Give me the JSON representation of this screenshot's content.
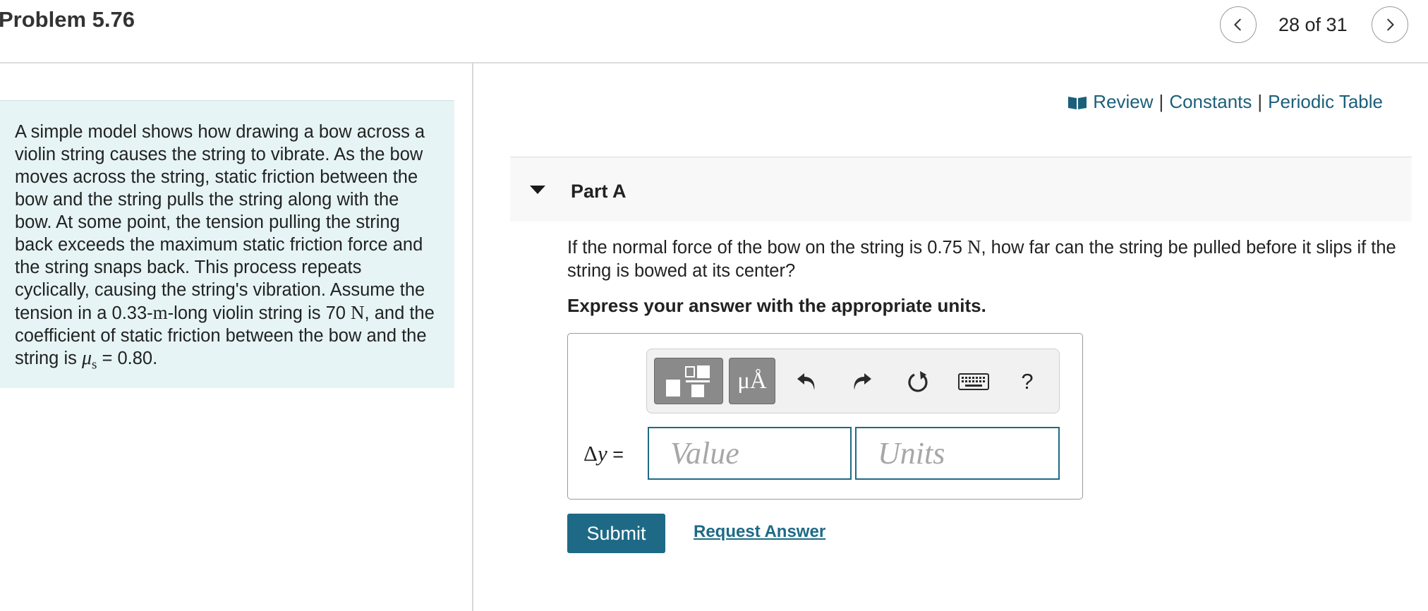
{
  "header": {
    "title": "Problem 5.76",
    "nav": {
      "counter": "28 of 31"
    }
  },
  "problem": {
    "text": {
      "p1": "A simple model shows how drawing a bow across a violin string causes the string to vibrate. As the bow moves across the string, static friction between the bow and the string pulls the string along with the bow. At some point, the tension pulling the string back exceeds the maximum static friction force and the string snaps back. This process repeats cyclically, causing the string's vibration. Assume the tension in a 0.33-",
      "unit_m": "m",
      "p2": "-long violin string is 70 ",
      "unit_n": "N",
      "p3": ", and the coefficient of static friction between the bow and the string is ",
      "mu_symbol": "μ",
      "mu_sub": "s",
      "p4": " = 0.80."
    }
  },
  "resources": {
    "review": "Review",
    "separator": "|",
    "constants": "Constants",
    "periodic_table": "Periodic Table"
  },
  "part": {
    "label": "Part A",
    "question": {
      "q1": "If the normal force of the bow on the string is 0.75 ",
      "unit_n": "N",
      "q2": ", how far can the string be pulled before it slips if the string is bowed at its center?"
    },
    "instruction": "Express your answer with the appropriate units."
  },
  "answer": {
    "toolbar": {
      "symbols_label": "μÅ",
      "help_label": "?",
      "icons": [
        "templates-icon",
        "undo-icon",
        "redo-icon",
        "reset-icon",
        "keyboard-icon"
      ]
    },
    "variable": {
      "delta": "Δ",
      "var": "y",
      "equals": " ="
    },
    "value_placeholder": "Value",
    "units_placeholder": "Units"
  },
  "actions": {
    "submit_label": "Submit",
    "request_label": "Request Answer"
  },
  "colors": {
    "accent": "#1e6a86",
    "link": "#1b5f7a",
    "problem_bg": "#e6f4f6"
  }
}
